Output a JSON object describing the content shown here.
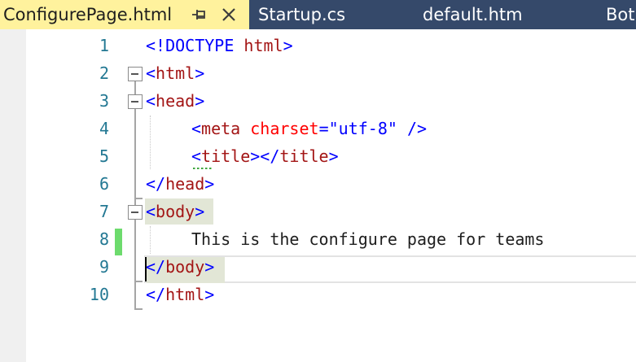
{
  "tabs": [
    {
      "label": "ConfigurePage.html",
      "active": true
    },
    {
      "label": "Startup.cs",
      "active": false
    },
    {
      "label": "default.htm",
      "active": false
    },
    {
      "label": "Bot",
      "active": false
    }
  ],
  "editor": {
    "line_numbers": [
      "1",
      "2",
      "3",
      "4",
      "5",
      "6",
      "7",
      "8",
      "9",
      "10"
    ],
    "lines": {
      "l1": [
        "<!DOCTYPE ",
        "html",
        ">"
      ],
      "l2": [
        "<",
        "html",
        ">"
      ],
      "l3": [
        "<",
        "head",
        ">"
      ],
      "l4": [
        "<",
        "meta ",
        "charset",
        "=",
        "\"utf-8\"",
        " />"
      ],
      "l5": [
        "<",
        "title",
        "></",
        "title",
        ">"
      ],
      "l6": [
        "</",
        "head",
        ">"
      ],
      "l7": [
        "<",
        "body",
        ">"
      ],
      "l8": "This is the configure page for teams",
      "l9": [
        "</",
        "body",
        ">"
      ],
      "l10": [
        "</",
        "html",
        ">"
      ]
    },
    "current_line": 9,
    "changed_line": 8
  },
  "colors": {
    "active_tab": "#fff29d",
    "tab_strip": "#35496a",
    "line_number": "#237893",
    "tag_bracket": "#0000ff",
    "tag_name": "#a31515",
    "attribute": "#ff0000",
    "string": "#0000ff",
    "change_marker": "#6ddb6d"
  }
}
